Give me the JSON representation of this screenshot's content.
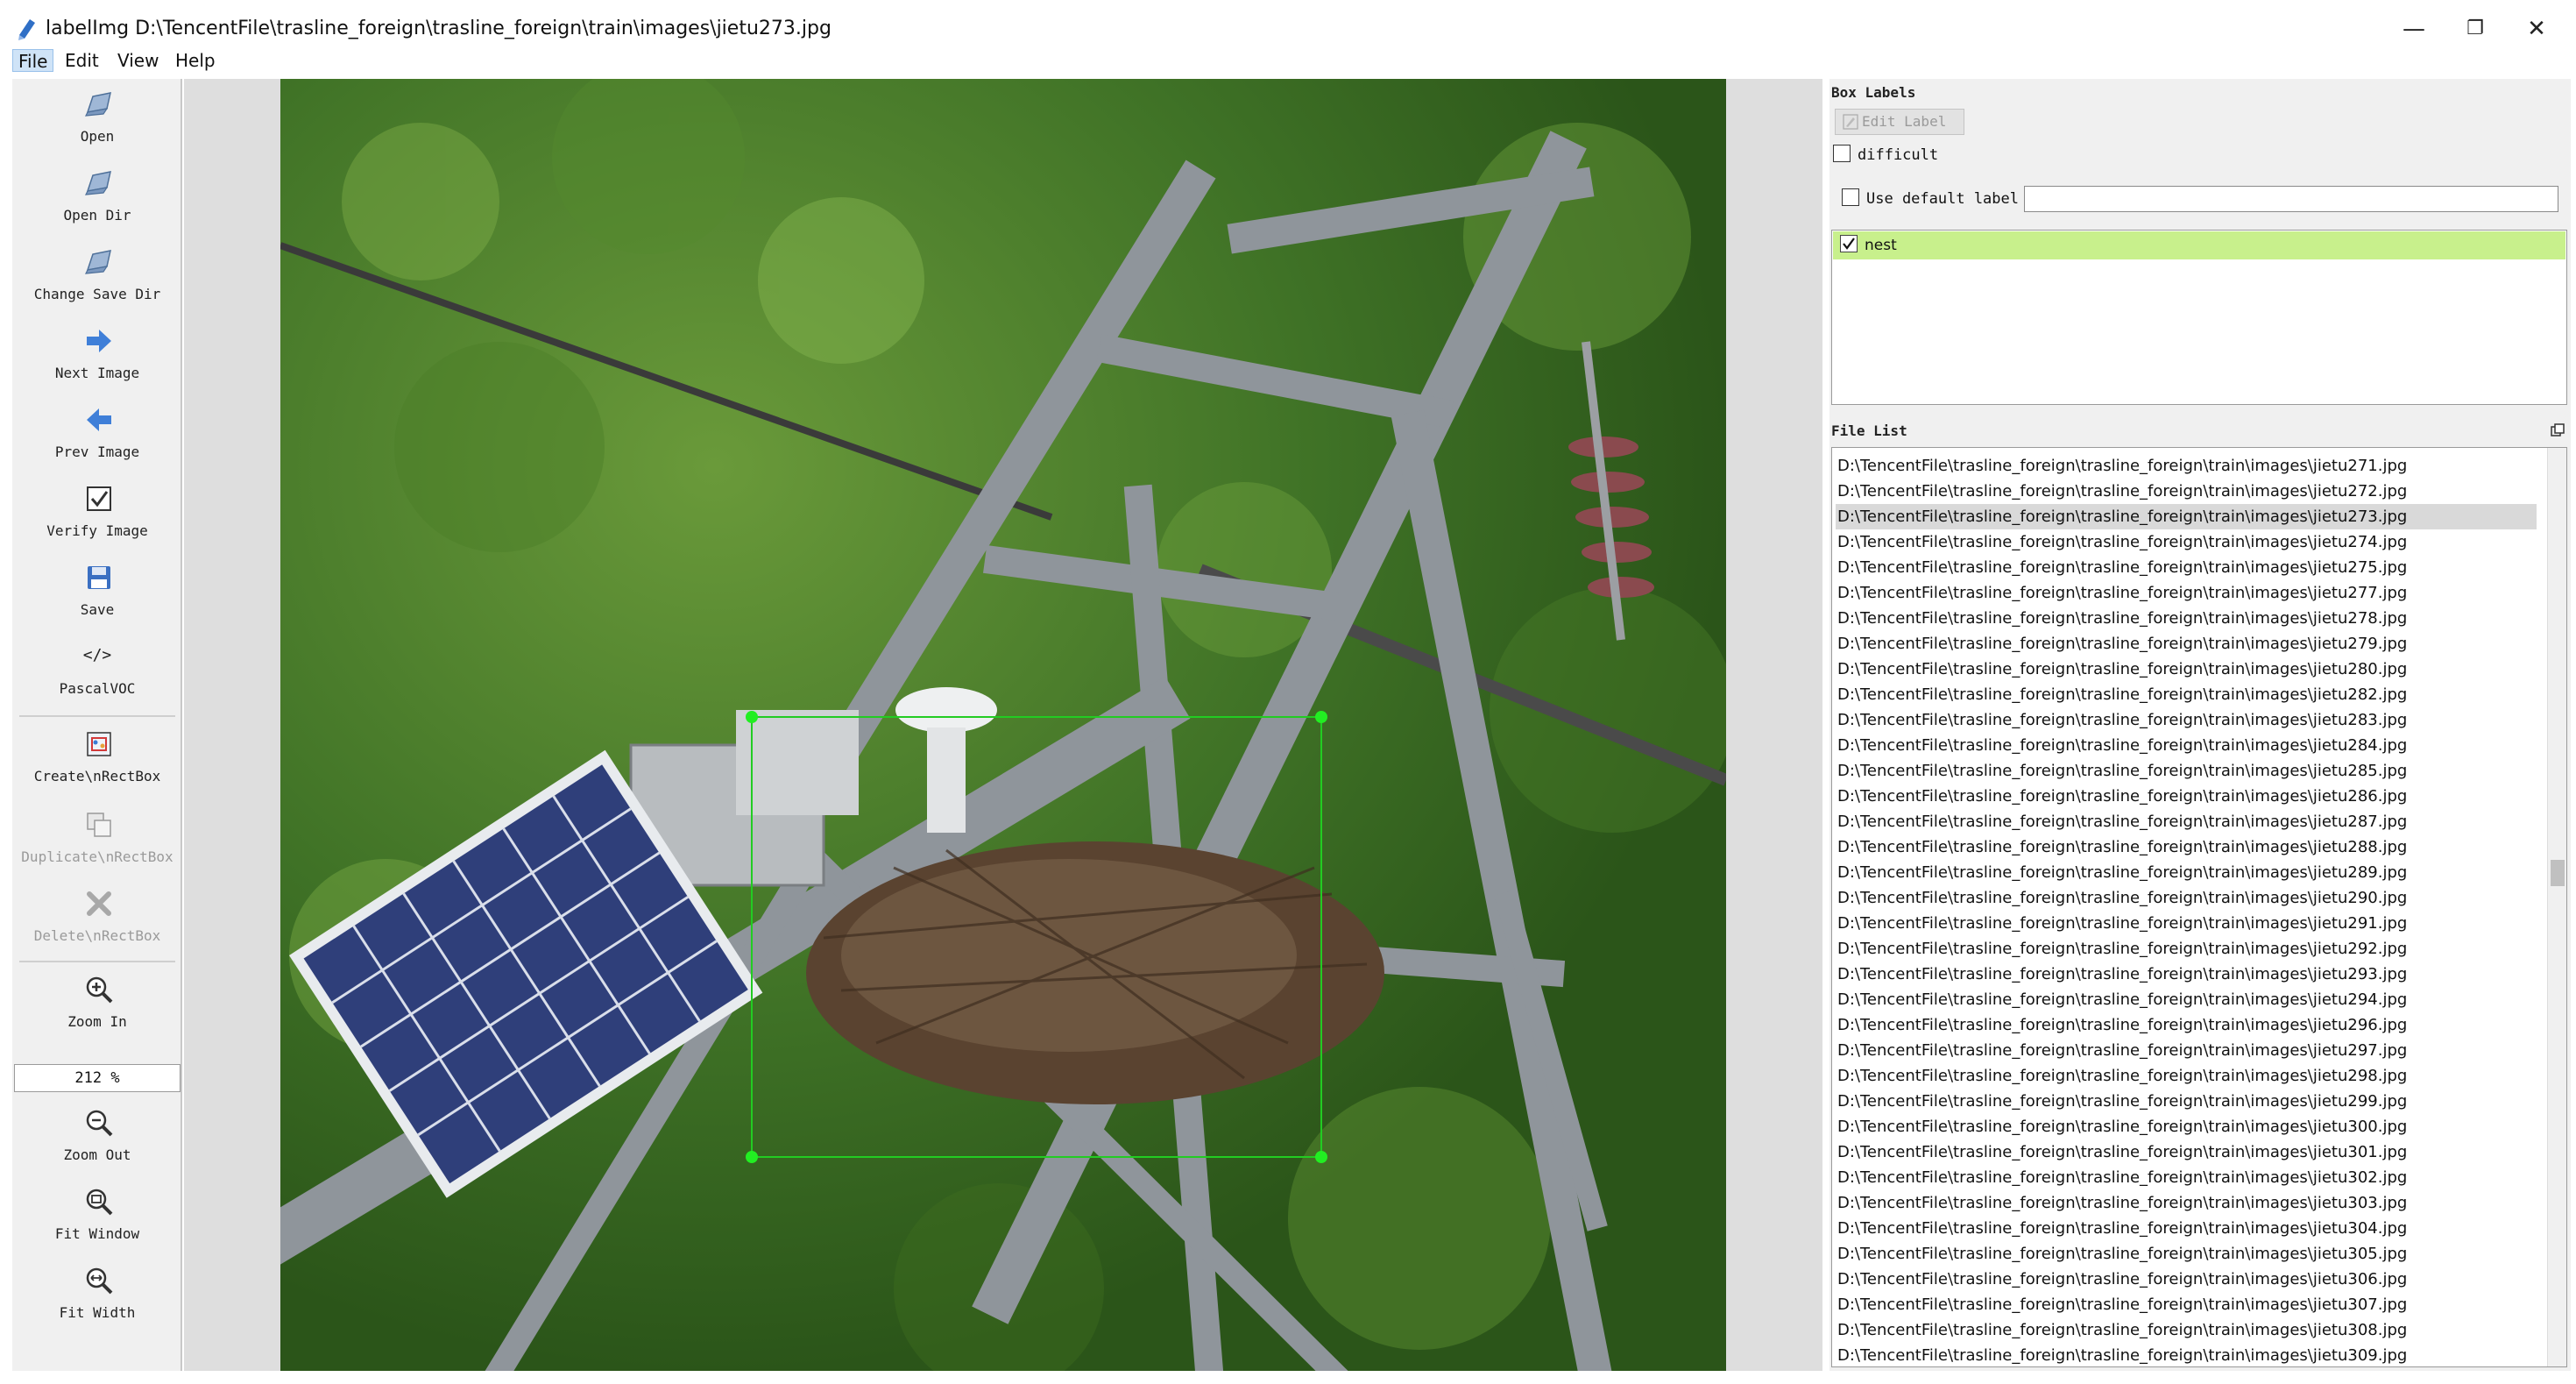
{
  "window": {
    "title": "labelImg D:\\TencentFile\\trasline_foreign\\trasline_foreign\\train\\images\\jietu273.jpg",
    "minimize": "—",
    "maximize": "❐",
    "close": "✕"
  },
  "menu": [
    {
      "label": "File",
      "active": true
    },
    {
      "label": "Edit"
    },
    {
      "label": "View"
    },
    {
      "label": "Help"
    }
  ],
  "toolbar": {
    "open": "Open",
    "open_dir": "Open Dir",
    "change_save_dir": "Change Save Dir",
    "next_image": "Next Image",
    "prev_image": "Prev Image",
    "verify_image": "Verify Image",
    "save": "Save",
    "format": "PascalVOC",
    "format_icon_text": "</>",
    "create_rectbox": "Create\\nRectBox",
    "duplicate_rectbox": "Duplicate\\nRectBox",
    "delete_rectbox": "Delete\\nRectBox",
    "zoom_in": "Zoom In",
    "zoom_value": "212 %",
    "zoom_out": "Zoom Out",
    "fit_window": "Fit Window",
    "fit_width": "Fit Width"
  },
  "box_labels": {
    "title": "Box Labels",
    "edit_label": "Edit Label",
    "difficult": "difficult",
    "use_default_label": "Use default label",
    "default_label_value": "",
    "labels": [
      {
        "name": "nest",
        "checked": true
      }
    ]
  },
  "file_list": {
    "title": "File List",
    "selected_index": 2,
    "files": [
      "D:\\TencentFile\\trasline_foreign\\trasline_foreign\\train\\images\\jietu271.jpg",
      "D:\\TencentFile\\trasline_foreign\\trasline_foreign\\train\\images\\jietu272.jpg",
      "D:\\TencentFile\\trasline_foreign\\trasline_foreign\\train\\images\\jietu273.jpg",
      "D:\\TencentFile\\trasline_foreign\\trasline_foreign\\train\\images\\jietu274.jpg",
      "D:\\TencentFile\\trasline_foreign\\trasline_foreign\\train\\images\\jietu275.jpg",
      "D:\\TencentFile\\trasline_foreign\\trasline_foreign\\train\\images\\jietu277.jpg",
      "D:\\TencentFile\\trasline_foreign\\trasline_foreign\\train\\images\\jietu278.jpg",
      "D:\\TencentFile\\trasline_foreign\\trasline_foreign\\train\\images\\jietu279.jpg",
      "D:\\TencentFile\\trasline_foreign\\trasline_foreign\\train\\images\\jietu280.jpg",
      "D:\\TencentFile\\trasline_foreign\\trasline_foreign\\train\\images\\jietu282.jpg",
      "D:\\TencentFile\\trasline_foreign\\trasline_foreign\\train\\images\\jietu283.jpg",
      "D:\\TencentFile\\trasline_foreign\\trasline_foreign\\train\\images\\jietu284.jpg",
      "D:\\TencentFile\\trasline_foreign\\trasline_foreign\\train\\images\\jietu285.jpg",
      "D:\\TencentFile\\trasline_foreign\\trasline_foreign\\train\\images\\jietu286.jpg",
      "D:\\TencentFile\\trasline_foreign\\trasline_foreign\\train\\images\\jietu287.jpg",
      "D:\\TencentFile\\trasline_foreign\\trasline_foreign\\train\\images\\jietu288.jpg",
      "D:\\TencentFile\\trasline_foreign\\trasline_foreign\\train\\images\\jietu289.jpg",
      "D:\\TencentFile\\trasline_foreign\\trasline_foreign\\train\\images\\jietu290.jpg",
      "D:\\TencentFile\\trasline_foreign\\trasline_foreign\\train\\images\\jietu291.jpg",
      "D:\\TencentFile\\trasline_foreign\\trasline_foreign\\train\\images\\jietu292.jpg",
      "D:\\TencentFile\\trasline_foreign\\trasline_foreign\\train\\images\\jietu293.jpg",
      "D:\\TencentFile\\trasline_foreign\\trasline_foreign\\train\\images\\jietu294.jpg",
      "D:\\TencentFile\\trasline_foreign\\trasline_foreign\\train\\images\\jietu296.jpg",
      "D:\\TencentFile\\trasline_foreign\\trasline_foreign\\train\\images\\jietu297.jpg",
      "D:\\TencentFile\\trasline_foreign\\trasline_foreign\\train\\images\\jietu298.jpg",
      "D:\\TencentFile\\trasline_foreign\\trasline_foreign\\train\\images\\jietu299.jpg",
      "D:\\TencentFile\\trasline_foreign\\trasline_foreign\\train\\images\\jietu300.jpg",
      "D:\\TencentFile\\trasline_foreign\\trasline_foreign\\train\\images\\jietu301.jpg",
      "D:\\TencentFile\\trasline_foreign\\trasline_foreign\\train\\images\\jietu302.jpg",
      "D:\\TencentFile\\trasline_foreign\\trasline_foreign\\train\\images\\jietu303.jpg",
      "D:\\TencentFile\\trasline_foreign\\trasline_foreign\\train\\images\\jietu304.jpg",
      "D:\\TencentFile\\trasline_foreign\\trasline_foreign\\train\\images\\jietu305.jpg",
      "D:\\TencentFile\\trasline_foreign\\trasline_foreign\\train\\images\\jietu306.jpg",
      "D:\\TencentFile\\trasline_foreign\\trasline_foreign\\train\\images\\jietu307.jpg",
      "D:\\TencentFile\\trasline_foreign\\trasline_foreign\\train\\images\\jietu308.jpg",
      "D:\\TencentFile\\trasline_foreign\\trasline_foreign\\train\\images\\jietu309.jpg"
    ]
  },
  "colors": {
    "selected_label_bg": "#c8f08c",
    "bbox_stroke": "#22cc22",
    "bbox_handle": "#22ee22"
  }
}
